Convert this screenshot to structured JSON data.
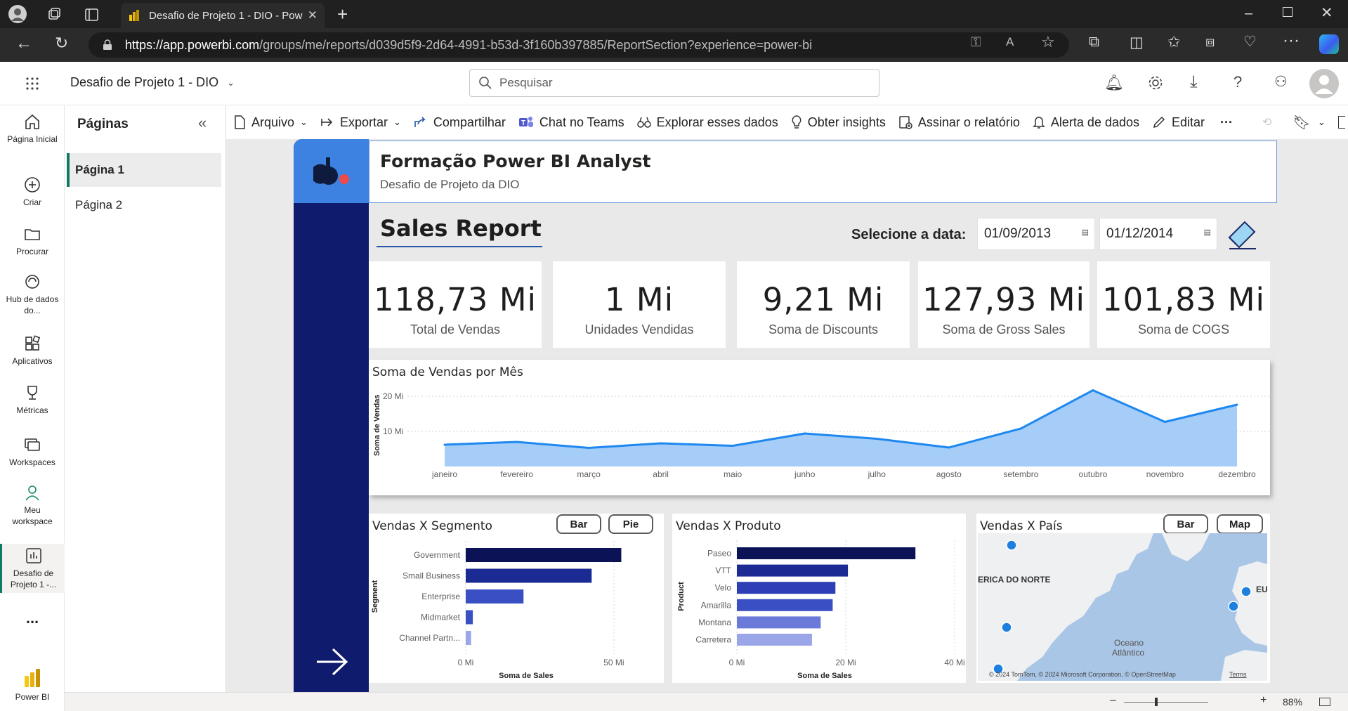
{
  "browser": {
    "tab_title": "Desafio de Projeto 1 - DIO - Pow",
    "url_host": "https://app.powerbi.com",
    "url_path": "/groups/me/reports/d039d5f9-2d64-4991-b53d-3f160b397885/ReportSection?experience=power-bi"
  },
  "app": {
    "report_name": "Desafio de Projeto 1 - DIO",
    "search_placeholder": "Pesquisar"
  },
  "nav": [
    {
      "label": "Página Inicial",
      "icon": "home-icon"
    },
    {
      "label": "Criar",
      "icon": "plus-circle-icon"
    },
    {
      "label": "Procurar",
      "icon": "folder-icon"
    },
    {
      "label": "Hub de dados do...",
      "icon": "data-hub-icon"
    },
    {
      "label": "Aplicativos",
      "icon": "apps-icon"
    },
    {
      "label": "Métricas",
      "icon": "trophy-icon"
    },
    {
      "label": "Workspaces",
      "icon": "workspaces-icon"
    },
    {
      "label": "Meu workspace",
      "icon": "person-icon"
    },
    {
      "label": "Desafio de Projeto 1 -...",
      "icon": "report-icon"
    },
    {
      "label": "...",
      "icon": "more-icon"
    },
    {
      "label": "Power BI",
      "icon": "powerbi-logo-icon"
    }
  ],
  "pages_panel": {
    "title": "Páginas",
    "pages": [
      "Página 1",
      "Página 2"
    ],
    "active": "Página 1"
  },
  "toolbar": {
    "arquivo": "Arquivo",
    "exportar": "Exportar",
    "compartilhar": "Compartilhar",
    "chat": "Chat no Teams",
    "explorar": "Explorar esses dados",
    "insights": "Obter insights",
    "assinar": "Assinar o relatório",
    "alerta": "Alerta de dados",
    "editar": "Editar",
    "more": "···"
  },
  "report": {
    "title": "Formação Power BI Analyst",
    "subtitle": "Desafio de Projeto da DIO",
    "heading": "Sales Report",
    "date_label": "Selecione a data:",
    "date_start": "01/09/2013",
    "date_end": "01/12/2014",
    "kpis": [
      {
        "value": "118,73 Mi",
        "label": "Total de Vendas"
      },
      {
        "value": "1 Mi",
        "label": "Unidades Vendidas"
      },
      {
        "value": "9,21 Mi",
        "label": "Soma de Discounts"
      },
      {
        "value": "127,93 Mi",
        "label": "Soma de Gross Sales"
      },
      {
        "value": "101,83 Mi",
        "label": "Soma de COGS"
      }
    ]
  },
  "charts": {
    "monthly_title": "Soma de Vendas por Mês",
    "segment_title": "Vendas X Segmento",
    "product_title": "Vendas X Produto",
    "country_title": "Vendas X País",
    "segment_toggle": [
      "Bar",
      "Pie"
    ],
    "country_toggle": [
      "Bar",
      "Map"
    ]
  },
  "map": {
    "label_na": "ERICA DO NORTE",
    "label_eu": "EU",
    "label_ocean": "Oceano Atlântico",
    "ocean_line1": "Oceano",
    "ocean_line2": "Atlântico",
    "attribution": "© 2024 TomTom, © 2024 Microsoft Corporation, © OpenStreetMap",
    "terms": "Terms",
    "water_color": "#aac6e6",
    "land_color": "#eef0f2"
  },
  "status": {
    "zoom": "88%"
  },
  "colors": {
    "navy": "#0f1b6c",
    "accent_blue": "#3d82e0",
    "area_fill": "#a5cdf7",
    "area_line": "#1e88f0"
  },
  "chart_data": [
    {
      "type": "area",
      "title": "Soma de Vendas por Mês",
      "ylabel": "Soma de Vendas",
      "x": [
        "janeiro",
        "fevereiro",
        "março",
        "abril",
        "maio",
        "junho",
        "julho",
        "agosto",
        "setembro",
        "outubro",
        "novembro",
        "dezembro"
      ],
      "y_ticks": [
        "10 Mi",
        "20 Mi"
      ],
      "values": [
        6.2,
        7.0,
        5.3,
        6.6,
        5.9,
        9.4,
        7.9,
        5.4,
        10.8,
        21.7,
        12.7,
        17.6
      ],
      "ylim": [
        0,
        25
      ],
      "grid": true
    },
    {
      "type": "bar",
      "orientation": "horizontal",
      "title": "Vendas X Segmento",
      "xlabel": "Soma de Sales",
      "ylabel": "Segment",
      "categories": [
        "Government",
        "Small Business",
        "Enterprise",
        "Midmarket",
        "Channel Partn..."
      ],
      "values": [
        52.5,
        42.5,
        19.5,
        2.4,
        1.8
      ],
      "x_ticks": [
        "0 Mi",
        "50 Mi"
      ],
      "xlim": [
        0,
        55
      ],
      "bar_colors": [
        "#0b1256",
        "#1c2b93",
        "#3a4fc4",
        "#3a4fc4",
        "#9aa6e8"
      ]
    },
    {
      "type": "bar",
      "orientation": "horizontal",
      "title": "Vendas X Produto",
      "xlabel": "Soma de Sales",
      "ylabel": "Product",
      "categories": [
        "Paseo",
        "VTT",
        "Velo",
        "Amarilla",
        "Montana",
        "Carretera"
      ],
      "values": [
        32.8,
        20.4,
        18.1,
        17.6,
        15.4,
        13.8
      ],
      "x_ticks": [
        "0 Mi",
        "20 Mi",
        "40 Mi"
      ],
      "xlim": [
        0,
        40
      ],
      "bar_colors": [
        "#0b1256",
        "#1c2b93",
        "#2d3eb6",
        "#3a4fc4",
        "#6b7ad8",
        "#9aa6e8"
      ]
    }
  ]
}
